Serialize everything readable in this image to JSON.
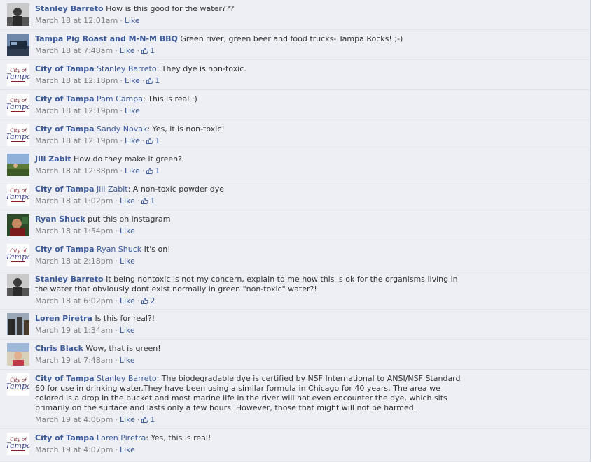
{
  "comments": [
    {
      "author": "Stanley Barreto",
      "avatar": "avatar-stanley",
      "mention": "",
      "text": "How is this good for the water???",
      "timestamp": "March 18 at 12:01am",
      "like_label": "Like",
      "likes": ""
    },
    {
      "author": "Tampa Pig Roast and M-N-M BBQ",
      "avatar": "avatar-bbq",
      "mention": "",
      "text": "Green river, green beer and food trucks- Tampa Rocks! ;-)",
      "timestamp": "March 18 at 7:48am",
      "like_label": "Like",
      "likes": "1"
    },
    {
      "author": "City of Tampa",
      "avatar": "avatar-city",
      "mention": "Stanley Barreto",
      "text": ": They dye is non-toxic.",
      "timestamp": "March 18 at 12:18pm",
      "like_label": "Like",
      "likes": "1"
    },
    {
      "author": "City of Tampa",
      "avatar": "avatar-city",
      "mention": "Pam Campa",
      "text": ": This is real :)",
      "timestamp": "March 18 at 12:19pm",
      "like_label": "Like",
      "likes": ""
    },
    {
      "author": "City of Tampa",
      "avatar": "avatar-city",
      "mention": "Sandy Novak",
      "text": ": Yes, it is non-toxic!",
      "timestamp": "March 18 at 12:19pm",
      "like_label": "Like",
      "likes": "1"
    },
    {
      "author": "Jill Zabit",
      "avatar": "avatar-jill",
      "mention": "",
      "text": "How do they make it green?",
      "timestamp": "March 18 at 12:38pm",
      "like_label": "Like",
      "likes": "1"
    },
    {
      "author": "City of Tampa",
      "avatar": "avatar-city",
      "mention": "Jill Zabit",
      "text": ": A non-toxic powder dye",
      "timestamp": "March 18 at 1:02pm",
      "like_label": "Like",
      "likes": "1"
    },
    {
      "author": "Ryan Shuck",
      "avatar": "avatar-ryan",
      "mention": "",
      "text": "put this on instagram",
      "timestamp": "March 18 at 1:54pm",
      "like_label": "Like",
      "likes": ""
    },
    {
      "author": "City of Tampa",
      "avatar": "avatar-city",
      "mention": "Ryan Shuck",
      "text": " It's on!",
      "timestamp": "March 18 at 2:18pm",
      "like_label": "Like",
      "likes": ""
    },
    {
      "author": "Stanley Barreto",
      "avatar": "avatar-stanley",
      "mention": "",
      "text": "It being nontoxic is not my concern, explain to me how this is ok for the organisms living in the water that obviously dont exist normally in green \"non-toxic\" water?!",
      "timestamp": "March 18 at 6:02pm",
      "like_label": "Like",
      "likes": "2"
    },
    {
      "author": "Loren Piretra",
      "avatar": "avatar-loren",
      "mention": "",
      "text": "Is this for real?!",
      "timestamp": "March 19 at 1:34am",
      "like_label": "Like",
      "likes": ""
    },
    {
      "author": "Chris Black",
      "avatar": "avatar-chris",
      "mention": "",
      "text": "Wow, that is green!",
      "timestamp": "March 19 at 7:48am",
      "like_label": "Like",
      "likes": ""
    },
    {
      "author": "City of Tampa",
      "avatar": "avatar-city",
      "mention": "Stanley Barreto",
      "text": ": The biodegradable dye is certified by NSF International to ANSI/NSF Standard 60 for use in drinking water.They have been using a similar formula in Chicago for 40 years. The area we colored is a drop in the bucket and most marine life in the river will not even encounter the dye, which sits primarily on the surface and lasts only a few hours. However, those that might will not be harmed.",
      "timestamp": "March 19 at 4:06pm",
      "like_label": "Like",
      "likes": "1"
    },
    {
      "author": "City of Tampa",
      "avatar": "avatar-city",
      "mention": "Loren Piretra",
      "text": ": Yes, this is real!",
      "timestamp": "March 19 at 4:07pm",
      "like_label": "Like",
      "likes": ""
    }
  ],
  "city_logo": {
    "line1": "City of",
    "line2": "Tampa"
  }
}
